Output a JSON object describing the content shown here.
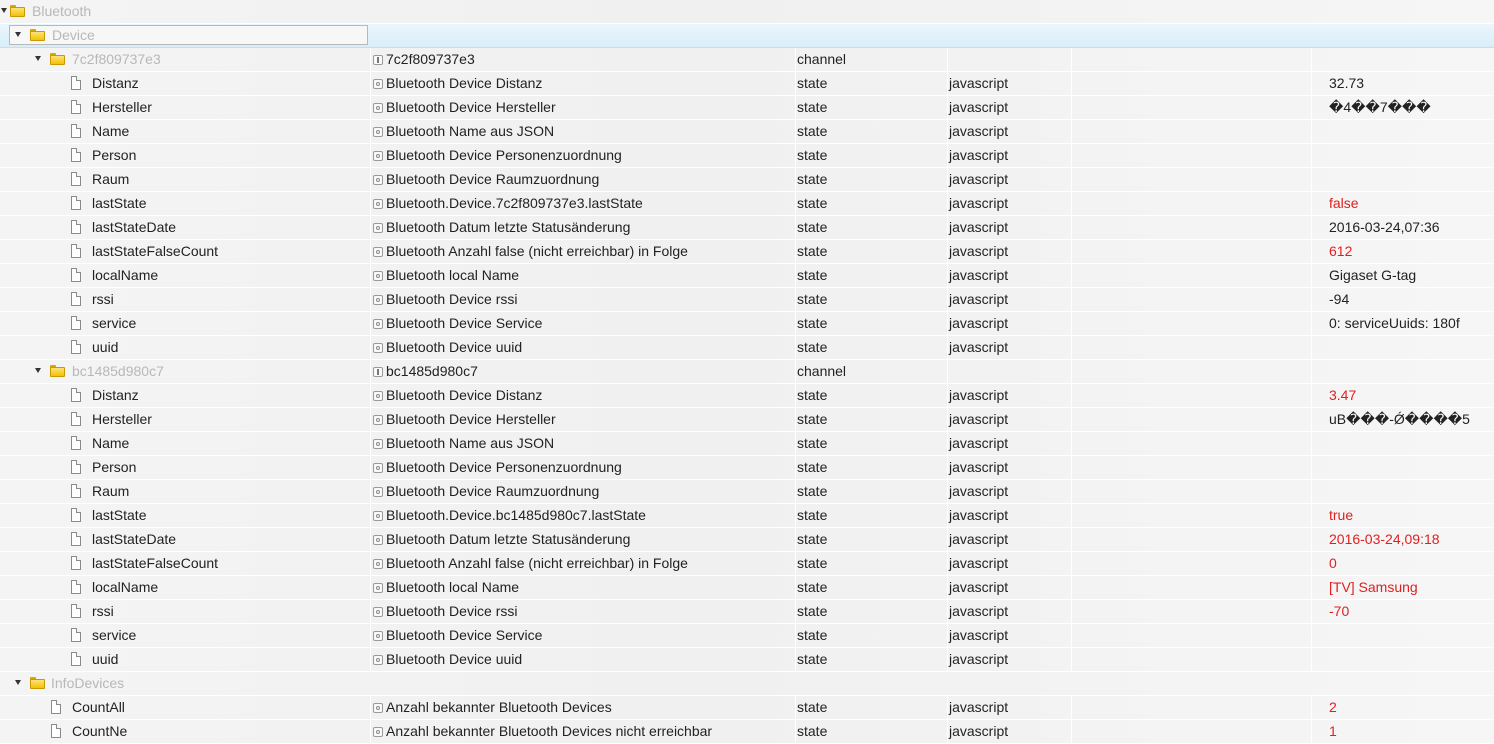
{
  "tree": {
    "root": {
      "label": "Bluetooth"
    },
    "device_folder": {
      "label": "Device"
    },
    "channels": [
      {
        "id": "7c2f809737e3",
        "desc": "7c2f809737e3",
        "type": "channel",
        "states": [
          {
            "name": "Distanz",
            "desc": "Bluetooth Device Distanz",
            "type": "state",
            "role": "javascript",
            "value": "32.73",
            "red": false
          },
          {
            "name": "Hersteller",
            "desc": "Bluetooth Device Hersteller",
            "type": "state",
            "role": "javascript",
            "value": "�4��7���",
            "red": false
          },
          {
            "name": "Name",
            "desc": "Bluetooth Name aus JSON",
            "type": "state",
            "role": "javascript",
            "value": "",
            "red": false
          },
          {
            "name": "Person",
            "desc": "Bluetooth Device Personenzuordnung",
            "type": "state",
            "role": "javascript",
            "value": "",
            "red": false
          },
          {
            "name": "Raum",
            "desc": "Bluetooth Device Raumzuordnung",
            "type": "state",
            "role": "javascript",
            "value": "",
            "red": false
          },
          {
            "name": "lastState",
            "desc": "Bluetooth.Device.7c2f809737e3.lastState",
            "type": "state",
            "role": "javascript",
            "value": "false",
            "red": true
          },
          {
            "name": "lastStateDate",
            "desc": "Bluetooth Datum letzte Statusänderung",
            "type": "state",
            "role": "javascript",
            "value": "2016-03-24,07:36",
            "red": false
          },
          {
            "name": "lastStateFalseCount",
            "desc": "Bluetooth Anzahl false (nicht erreichbar) in Folge",
            "type": "state",
            "role": "javascript",
            "value": "612",
            "red": true
          },
          {
            "name": "localName",
            "desc": "Bluetooth local Name",
            "type": "state",
            "role": "javascript",
            "value": "Gigaset G-tag",
            "red": false
          },
          {
            "name": "rssi",
            "desc": "Bluetooth Device rssi",
            "type": "state",
            "role": "javascript",
            "value": "-94",
            "red": false
          },
          {
            "name": "service",
            "desc": "Bluetooth Device Service",
            "type": "state",
            "role": "javascript",
            "value": "0: serviceUuids: 180f",
            "red": false
          },
          {
            "name": "uuid",
            "desc": "Bluetooth Device uuid",
            "type": "state",
            "role": "javascript",
            "value": "",
            "red": false
          }
        ]
      },
      {
        "id": "bc1485d980c7",
        "desc": "bc1485d980c7",
        "type": "channel",
        "states": [
          {
            "name": "Distanz",
            "desc": "Bluetooth Device Distanz",
            "type": "state",
            "role": "javascript",
            "value": "3.47",
            "red": true
          },
          {
            "name": "Hersteller",
            "desc": "Bluetooth Device Hersteller",
            "type": "state",
            "role": "javascript",
            "value": "uB���-Ǿ����5",
            "red": false
          },
          {
            "name": "Name",
            "desc": "Bluetooth Name aus JSON",
            "type": "state",
            "role": "javascript",
            "value": "",
            "red": false
          },
          {
            "name": "Person",
            "desc": "Bluetooth Device Personenzuordnung",
            "type": "state",
            "role": "javascript",
            "value": "",
            "red": false
          },
          {
            "name": "Raum",
            "desc": "Bluetooth Device Raumzuordnung",
            "type": "state",
            "role": "javascript",
            "value": "",
            "red": false
          },
          {
            "name": "lastState",
            "desc": "Bluetooth.Device.bc1485d980c7.lastState",
            "type": "state",
            "role": "javascript",
            "value": "true",
            "red": true
          },
          {
            "name": "lastStateDate",
            "desc": "Bluetooth Datum letzte Statusänderung",
            "type": "state",
            "role": "javascript",
            "value": "2016-03-24,09:18",
            "red": true
          },
          {
            "name": "lastStateFalseCount",
            "desc": "Bluetooth Anzahl false (nicht erreichbar) in Folge",
            "type": "state",
            "role": "javascript",
            "value": "0",
            "red": true
          },
          {
            "name": "localName",
            "desc": "Bluetooth local Name",
            "type": "state",
            "role": "javascript",
            "value": "[TV] Samsung",
            "red": true
          },
          {
            "name": "rssi",
            "desc": "Bluetooth Device rssi",
            "type": "state",
            "role": "javascript",
            "value": "-70",
            "red": true
          },
          {
            "name": "service",
            "desc": "Bluetooth Device Service",
            "type": "state",
            "role": "javascript",
            "value": "",
            "red": false
          },
          {
            "name": "uuid",
            "desc": "Bluetooth Device uuid",
            "type": "state",
            "role": "javascript",
            "value": "",
            "red": false
          }
        ]
      }
    ],
    "info_folder": {
      "label": "InfoDevices"
    },
    "info_states": [
      {
        "name": "CountAll",
        "desc": "Anzahl bekannter Bluetooth Devices",
        "type": "state",
        "role": "javascript",
        "value": "2",
        "red": true
      },
      {
        "name": "CountNe",
        "desc": "Anzahl bekannter Bluetooth Devices nicht erreichbar",
        "type": "state",
        "role": "javascript",
        "value": "1",
        "red": true
      }
    ]
  },
  "colors": {
    "value_red": "#e02020",
    "dim_text": "#b8b8b8",
    "folder": "#f2c200"
  },
  "icons": {
    "folder": "folder-icon",
    "file": "file-icon",
    "state": "state-icon",
    "channel": "channel-icon",
    "toggle": "expand-toggle-icon"
  }
}
